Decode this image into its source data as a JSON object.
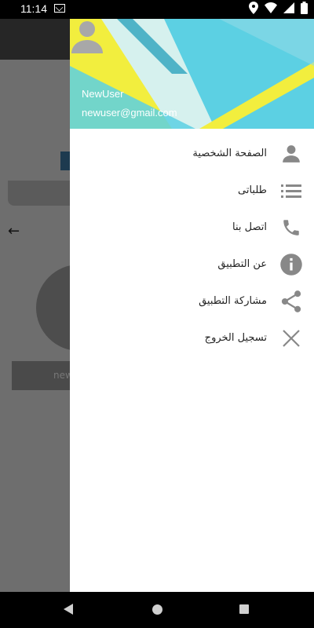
{
  "status_bar": {
    "time": "11:14"
  },
  "background_app": {
    "field_text": "new"
  },
  "drawer": {
    "header": {
      "name": "NewUser",
      "email": "newuser@gmail.com",
      "colors": {
        "teal": "#5cd0e3",
        "yellow": "#f2ee3e",
        "light": "#d6f1ee"
      }
    },
    "menu": [
      {
        "label": "الصفحة الشخصية",
        "icon": "person-icon"
      },
      {
        "label": "طلباتى",
        "icon": "list-icon"
      },
      {
        "label": "اتصل بنا",
        "icon": "phone-icon"
      },
      {
        "label": "عن التطبيق",
        "icon": "info-icon"
      },
      {
        "label": "مشاركة التطبيق",
        "icon": "share-icon"
      },
      {
        "label": "تسجيل الخروج",
        "icon": "close-icon"
      }
    ]
  }
}
